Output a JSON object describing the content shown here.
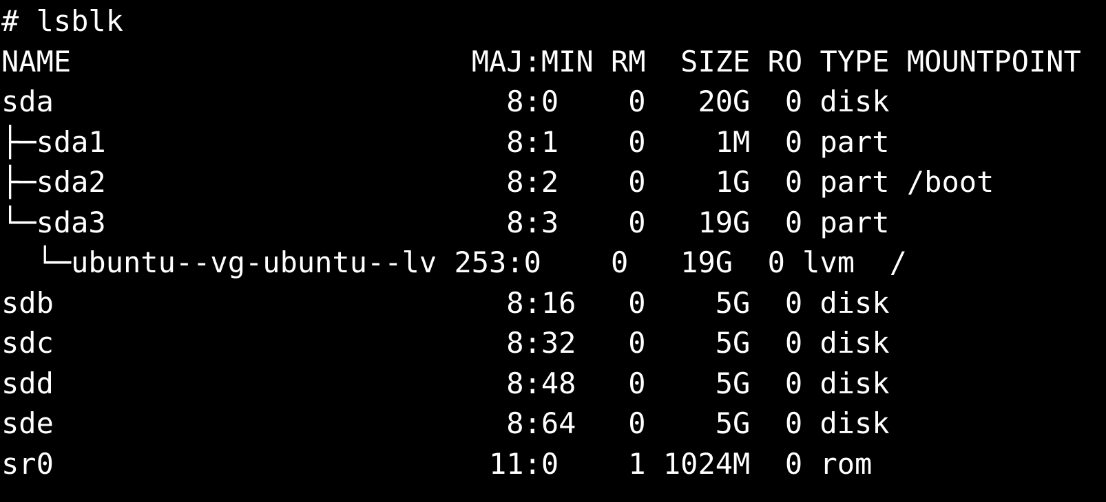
{
  "terminal": {
    "prompt": "# ",
    "command": "lsblk",
    "header": "NAME                       MAJ:MIN RM  SIZE RO TYPE MOUNTPOINT",
    "rows": [
      "sda                          8:0    0   20G  0 disk ",
      "├─sda1                       8:1    0    1M  0 part ",
      "├─sda2                       8:2    0    1G  0 part /boot",
      "└─sda3                       8:3    0   19G  0 part ",
      "  └─ubuntu--vg-ubuntu--lv 253:0    0   19G  0 lvm  /",
      "sdb                          8:16   0    5G  0 disk ",
      "sdc                          8:32   0    5G  0 disk ",
      "sdd                          8:48   0    5G  0 disk ",
      "sde                          8:64   0    5G  0 disk ",
      "sr0                         11:0    1 1024M  0 rom  "
    ],
    "colors": {
      "background": "#000000",
      "foreground": "#ffffff"
    }
  }
}
